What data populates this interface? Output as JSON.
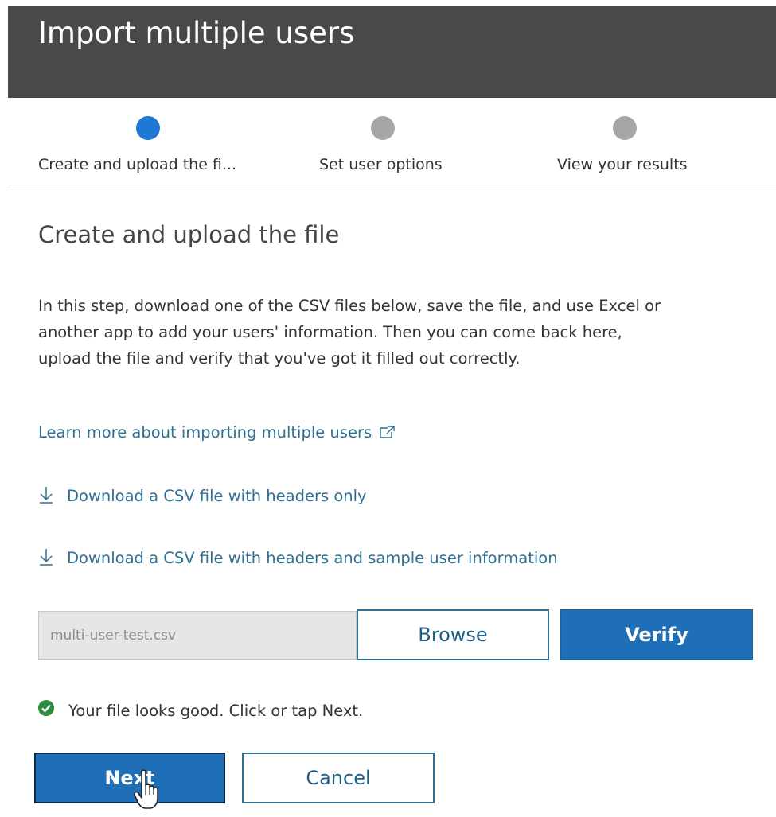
{
  "header": {
    "title": "Import multiple users"
  },
  "stepper": {
    "steps": [
      {
        "label": "Create and upload the fi...",
        "state": "active"
      },
      {
        "label": "Set user options",
        "state": "inactive"
      },
      {
        "label": "View your results",
        "state": "inactive"
      }
    ],
    "colors": {
      "active": "#1e78d4",
      "inactive": "#a6a6a6"
    }
  },
  "content": {
    "section_title": "Create and upload the file",
    "intro_lines": [
      "In this step, download one of the CSV files below, save the file, and use Excel or",
      "another app to add your users' information. Then you can come back here,",
      "upload the file and verify that you've got it filled out correctly."
    ],
    "learn_more_link": "Learn more about importing multiple users",
    "learn_more_icon": "external-link-icon",
    "download_links": [
      {
        "label": "Download a CSV file with headers only",
        "icon": "download-arrow-icon"
      },
      {
        "label": "Download a CSV file with headers and sample user information",
        "icon": "download-arrow-icon"
      }
    ]
  },
  "file_picker": {
    "value": "multi-user-test.csv",
    "browse_label": "Browse",
    "verify_label": "Verify"
  },
  "status": {
    "message": "Your file looks good. Click or tap Next.",
    "icon": "check-circle-icon",
    "color": "#2e8b3e"
  },
  "footer": {
    "next_label": "Next",
    "cancel_label": "Cancel"
  },
  "colors": {
    "header_bg": "#494949",
    "link": "#2f6f91",
    "primary": "#1e6fb8"
  }
}
